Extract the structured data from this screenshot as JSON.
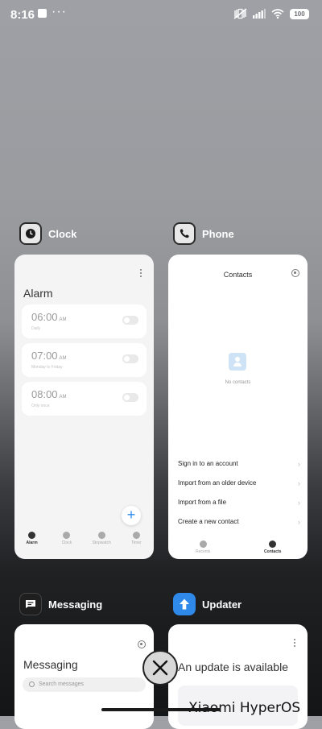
{
  "status_bar": {
    "time": "8:16",
    "dots": "···",
    "battery": "100"
  },
  "apps": {
    "clock": {
      "label": "Clock",
      "card": {
        "title": "Alarm",
        "alarms": [
          {
            "time": "06:00",
            "ampm": "AM",
            "sub": "Daily"
          },
          {
            "time": "07:00",
            "ampm": "AM",
            "sub": "Monday to Friday"
          },
          {
            "time": "08:00",
            "ampm": "AM",
            "sub": "Only once"
          }
        ],
        "fab": "+",
        "nav": [
          "Alarm",
          "Clock",
          "Stopwatch",
          "Timer"
        ]
      }
    },
    "phone": {
      "label": "Phone",
      "card": {
        "title": "Contacts",
        "empty_text": "No contacts",
        "menu": [
          "Sign in to an account",
          "Import from an older device",
          "Import from a file",
          "Create a new contact"
        ],
        "nav": [
          "Recents",
          "Contacts"
        ]
      }
    },
    "messaging": {
      "label": "Messaging",
      "card": {
        "title": "Messaging",
        "search_placeholder": "Search messages"
      }
    },
    "updater": {
      "label": "Updater",
      "card": {
        "title": "An update is available"
      }
    }
  },
  "branding": "Xiaomi HyperOS",
  "colors": {
    "accent": "#2d8cf0",
    "updater_icon": "#2f89e8"
  }
}
